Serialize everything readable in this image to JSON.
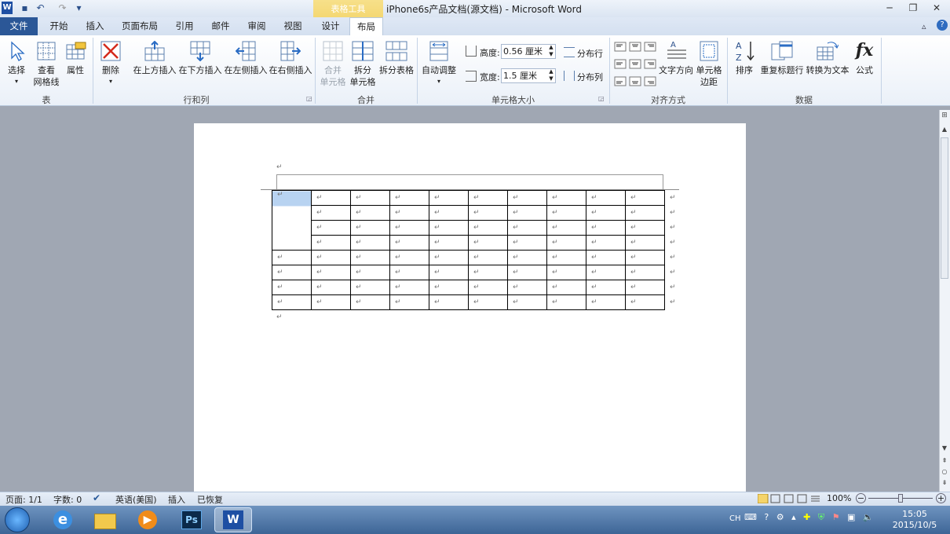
{
  "titlebar": {
    "contextual_label": "表格工具",
    "title": "iPhone6s产品文档(源文档)  -  Microsoft Word",
    "logo": "W"
  },
  "tabs": [
    "文件",
    "开始",
    "插入",
    "页面布局",
    "引用",
    "邮件",
    "审阅",
    "视图",
    "设计",
    "布局"
  ],
  "ribbon": {
    "groups": {
      "table": "表",
      "rows_cols": "行和列",
      "merge": "合并",
      "cell_size": "单元格大小",
      "align": "对齐方式",
      "data": "数据"
    },
    "buttons": {
      "select": "选择",
      "view_gridlines_1": "查看",
      "view_gridlines_2": "网格线",
      "properties": "属性",
      "delete": "删除",
      "insert_above": "在上方插入",
      "insert_below": "在下方插入",
      "insert_left": "在左侧插入",
      "insert_right": "在右侧插入",
      "merge_1": "合并",
      "merge_2": "单元格",
      "split_cells_1": "拆分",
      "split_cells_2": "单元格",
      "split_table": "拆分表格",
      "autofit": "自动调整",
      "height_label": "高度:",
      "height_value": "0.56 厘米",
      "width_label": "宽度:",
      "width_value": "1.5 厘米",
      "distribute_rows": "分布行",
      "distribute_cols": "分布列",
      "text_direction": "文字方向",
      "cell_margins_1": "单元格",
      "cell_margins_2": "边距",
      "sort": "排序",
      "repeat_header": "重复标题行",
      "convert_text": "转换为文本",
      "formula": "公式"
    }
  },
  "document": {
    "para_mark": "↵"
  },
  "status": {
    "page": "页面: 1/1",
    "words": "字数: 0",
    "language": "英语(美国)",
    "mode": "插入",
    "state": "已恢复",
    "zoom": "100%"
  },
  "taskbar": {
    "ime": "CH",
    "time": "15:05",
    "date": "2015/10/5"
  },
  "colors": {
    "accent": "#2b5797",
    "context_tab": "#f1cf5a",
    "selected_cell": "#b8d3f1"
  }
}
